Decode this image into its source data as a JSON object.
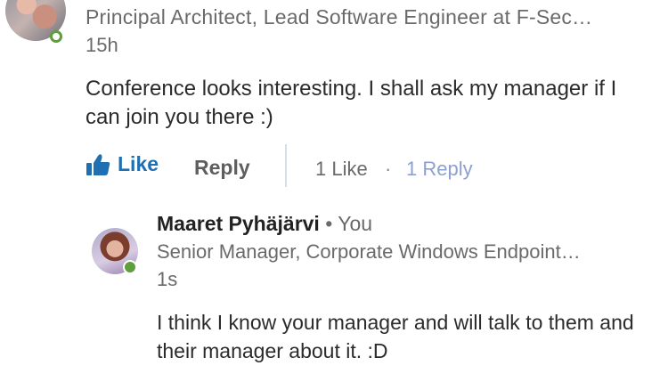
{
  "first_comment": {
    "headline": "Principal Architect, Lead Software Engineer at F-Sec…",
    "timestamp": "15h",
    "text": "Conference looks interesting. I shall ask my manager if I can join you there :)",
    "actions": {
      "like_label": "Like",
      "reply_label": "Reply",
      "like_count": "1 Like",
      "separator": "·",
      "reply_count": "1 Reply"
    }
  },
  "reply": {
    "author_name": "Maaret Pyhäjärvi",
    "you_tag": "• You",
    "headline": "Senior Manager, Corporate Windows Endpoint…",
    "timestamp": "1s",
    "text": "I think I know your manager and will talk to them and their manager about it. :D"
  },
  "colors": {
    "accent": "#1f6fb3",
    "online": "#5e9e3c",
    "reply_count": "#8ea0cf"
  }
}
